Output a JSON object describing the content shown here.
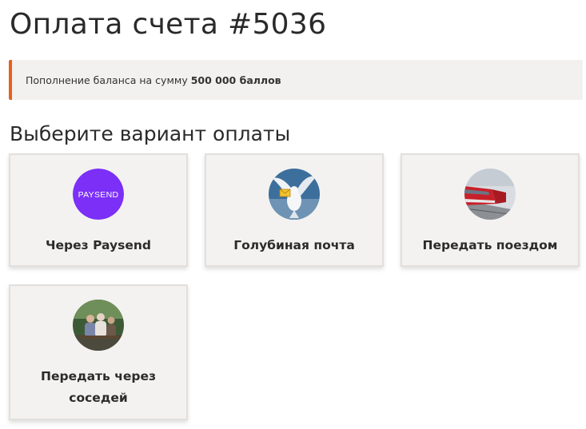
{
  "page": {
    "title": "Оплата счета #5036"
  },
  "notice": {
    "text": "Пополнение баланса на сумму",
    "amount": "500 000 баллов",
    "accent_color": "#e8601c"
  },
  "payment": {
    "heading": "Выберите вариант оплаты",
    "options": [
      {
        "label": "Через Paysend",
        "icon": "paysend-logo",
        "logo_text": "PAYSEND",
        "icon_color": "#7b2ff7"
      },
      {
        "label": "Голубиная почта",
        "icon": "pigeon-mail-icon"
      },
      {
        "label": "Передать поездом",
        "icon": "train-icon"
      },
      {
        "label": "Передать через соседей",
        "icon": "neighbors-icon"
      }
    ]
  }
}
